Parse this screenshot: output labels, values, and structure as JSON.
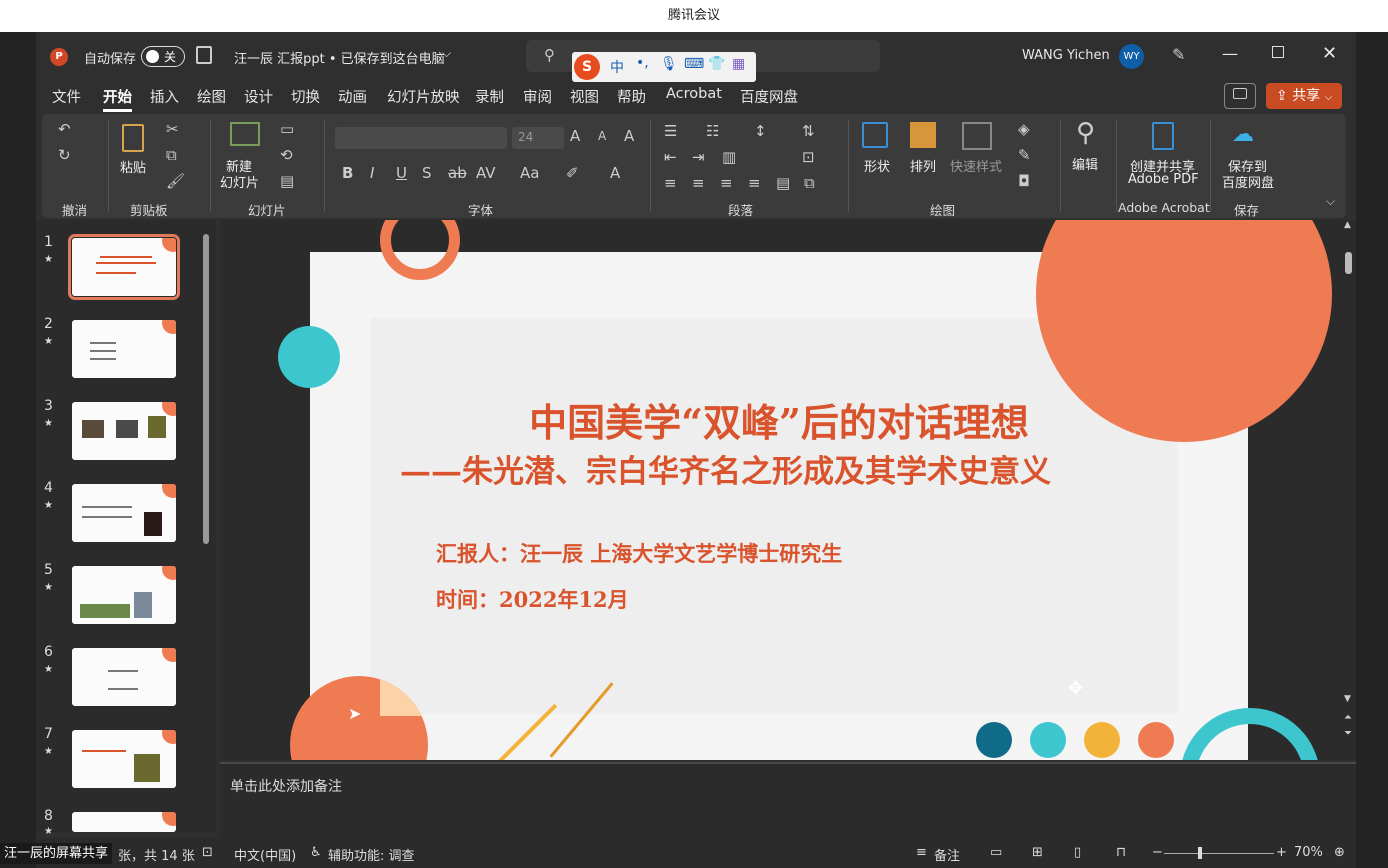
{
  "meeting": {
    "title": "腾讯会议",
    "share_label": "汪一辰的屏幕共享"
  },
  "titlebar": {
    "autosave_label": "自动保存",
    "autosave_state": "关",
    "doc_title": "汪一辰 汇报ppt • 已保存到这台电脑",
    "user_name": "WANG Yichen",
    "user_initials": "WY"
  },
  "ime": {
    "mode": "中",
    "punct": "•,"
  },
  "menu": [
    "文件",
    "开始",
    "插入",
    "绘图",
    "设计",
    "切换",
    "动画",
    "幻灯片放映",
    "录制",
    "审阅",
    "视图",
    "帮助",
    "Acrobat",
    "百度网盘"
  ],
  "share_button": "共享",
  "ribbon": {
    "groups": [
      "撤消",
      "剪贴板",
      "幻灯片",
      "字体",
      "段落",
      "绘图",
      "Adobe Acrobat",
      "保存"
    ],
    "paste": "粘贴",
    "new_slide": "新建",
    "new_slide2": "幻灯片",
    "font_size": "24",
    "shape": "形状",
    "arrange": "排列",
    "quick_style": "快速样式",
    "edit": "编辑",
    "acrobat1": "创建并共享",
    "acrobat2": "Adobe PDF",
    "baidu1": "保存到",
    "baidu2": "百度网盘"
  },
  "slide": {
    "title": "中国美学“双峰”后的对话理想",
    "subtitle": "——朱光潜、宗白华齐名之形成及其学术史意义",
    "reporter": "汇报人：汪一辰  上海大学文艺学博士研究生",
    "date": "时间：2022年12月",
    "dot_colors": [
      "#0f6b87",
      "#3ec6cf",
      "#f3b33a",
      "#ef7b52"
    ]
  },
  "thumbnails": [
    "1",
    "2",
    "3",
    "4",
    "5",
    "6",
    "7",
    "8"
  ],
  "notes_placeholder": "单击此处添加备注",
  "status": {
    "slide_count": "张，共 14 张",
    "language": "中文(中国)",
    "accessibility": "辅助功能: 调查",
    "notes": "备注",
    "zoom": "70%"
  }
}
